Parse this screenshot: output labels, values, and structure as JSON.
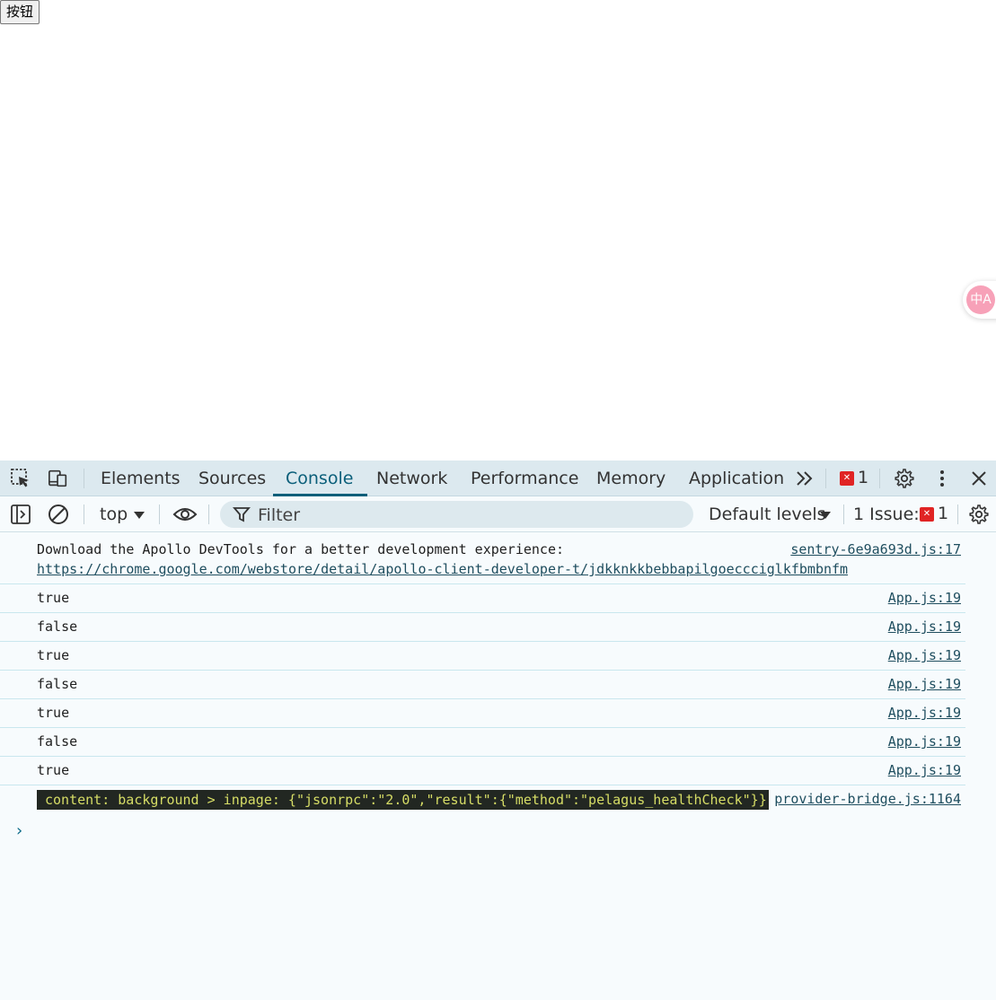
{
  "page": {
    "button_label": "按钮",
    "translate_label": "中A"
  },
  "devtools": {
    "tabs": [
      {
        "label": "Elements"
      },
      {
        "label": "Sources"
      },
      {
        "label": "Console"
      },
      {
        "label": "Network"
      },
      {
        "label": "Performance"
      },
      {
        "label": "Memory"
      },
      {
        "label": "Application"
      }
    ],
    "active_tab": "Console",
    "more_tabs_label": "»",
    "error_count": "1",
    "toolbar": {
      "context": "top",
      "filter_placeholder": "Filter",
      "levels": "Default levels",
      "issues_label": "1 Issue:",
      "issues_count": "1"
    },
    "console": {
      "messages": [
        {
          "text": "Download the Apollo DevTools for a better development experience:",
          "link": "https://chrome.google.com/webstore/detail/apollo-client-developer-t/jdkknkkbebbapilgoeccciglkfbmbnfm",
          "source": "sentry-6e9a693d.js:17"
        },
        {
          "text": "true",
          "source": "App.js:19"
        },
        {
          "text": "false",
          "source": "App.js:19"
        },
        {
          "text": "true",
          "source": "App.js:19"
        },
        {
          "text": "false",
          "source": "App.js:19"
        },
        {
          "text": "true",
          "source": "App.js:19"
        },
        {
          "text": "false",
          "source": "App.js:19"
        },
        {
          "text": "true",
          "source": "App.js:19"
        },
        {
          "text": "content: background > inpage: {\"jsonrpc\":\"2.0\",\"result\":{\"method\":\"pelagus_healthCheck\"}}",
          "source": "provider-bridge.js:1164"
        }
      ],
      "prompt": "›"
    },
    "colors": {
      "accent": "#0b5f7a",
      "error": "#e02424",
      "panel_bg": "#f7fbfd",
      "tabbar_bg": "#dce9ef"
    }
  }
}
